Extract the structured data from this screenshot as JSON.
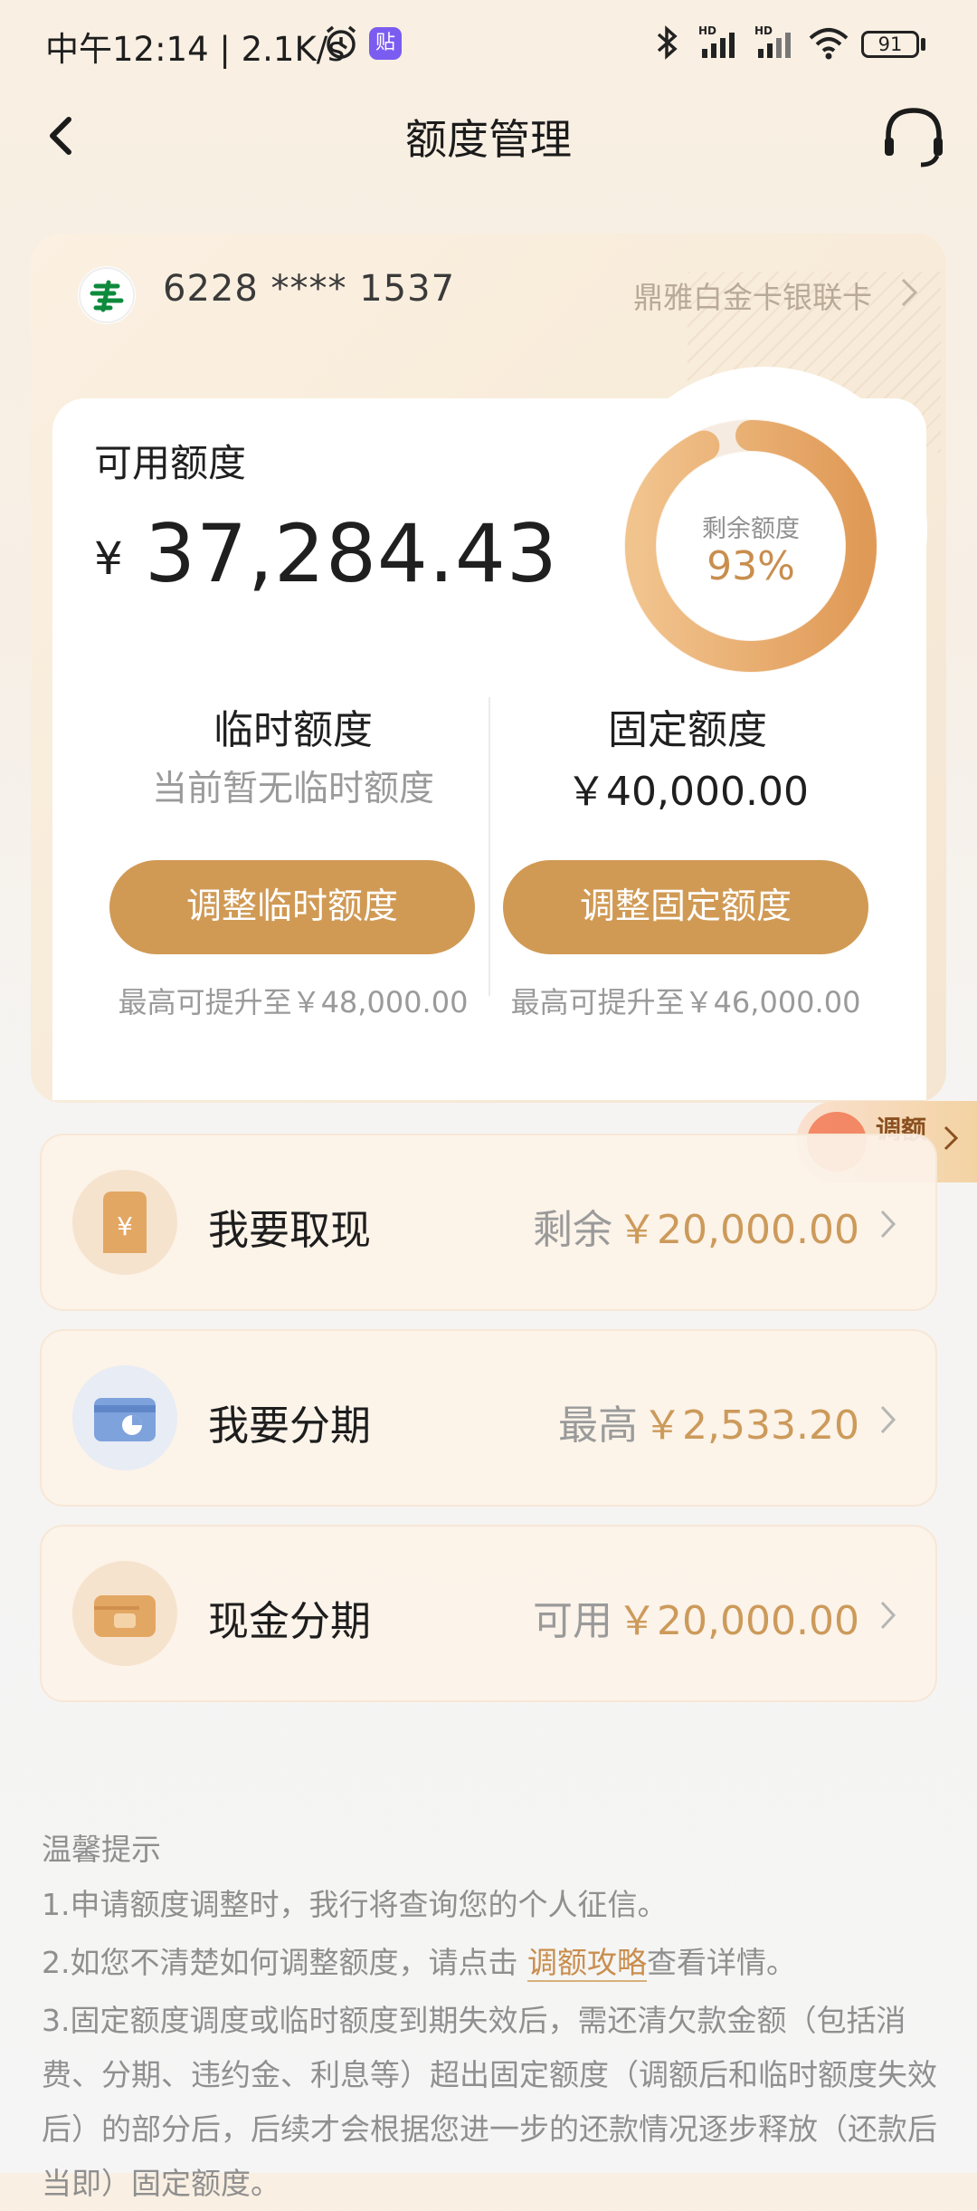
{
  "status_bar": {
    "time": "中午12:14 | 2.1K/s",
    "battery": "91"
  },
  "header": {
    "title": "额度管理"
  },
  "card": {
    "number": "6228 **** 1537",
    "type": "鼎雅白金卡银联卡"
  },
  "available": {
    "label": "可用额度",
    "currency": "¥",
    "amount": "37,284.43",
    "ring_label": "剩余额度",
    "ring_percent": "93%",
    "ring_fraction": 0.93
  },
  "temp_limit": {
    "title": "临时额度",
    "subtitle": "当前暂无临时额度",
    "button": "调整临时额度",
    "note": "最高可提升至￥48,000.00"
  },
  "fixed_limit": {
    "title": "固定额度",
    "amount": "￥40,000.00",
    "button": "调整固定额度",
    "note": "最高可提升至￥46,000.00"
  },
  "side_tab": {
    "label": "调额"
  },
  "services": [
    {
      "title": "我要取现",
      "label": "剩余",
      "value": "￥20,000.00",
      "icon": "cash-withdraw-icon"
    },
    {
      "title": "我要分期",
      "label": "最高",
      "value": "￥2,533.20",
      "icon": "installment-card-icon"
    },
    {
      "title": "现金分期",
      "label": "可用",
      "value": "￥20,000.00",
      "icon": "wallet-icon"
    }
  ],
  "tips": {
    "title": "温馨提示",
    "item1": "1.申请额度调整时，我行将查询您的个人征信。",
    "item2_pre": "2.如您不清楚如何调整额度，请点击 ",
    "item2_link": "调额攻略",
    "item2_post": "查看详情。",
    "item3": "3.固定额度调度或临时额度到期失效后，需还清欠款金额（包括消费、分期、违约金、利息等）超出固定额度（调额后和临时额度失效后）的部分后，后续才会根据您进一步的还款情况逐步释放（还款后当即）固定额度。"
  },
  "colors": {
    "accent": "#d09a55",
    "amount_gold": "#cc9a5a",
    "ring_start": "#f1c38d",
    "ring_end": "#e09a57"
  }
}
